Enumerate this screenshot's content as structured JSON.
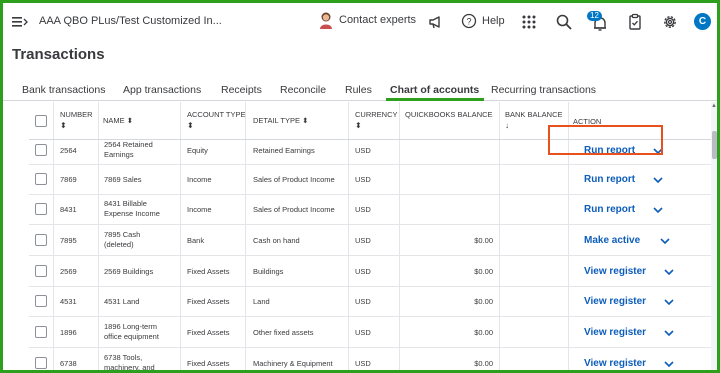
{
  "header": {
    "company_name": "AAA QBO PLus/Test Customized In...",
    "contact_label": "Contact experts",
    "help_label": "Help",
    "notification_count": "12",
    "avatar_initial": "C"
  },
  "page": {
    "title": "Transactions"
  },
  "tabs": [
    {
      "label": "Bank transactions",
      "active": false
    },
    {
      "label": "App transactions",
      "active": false
    },
    {
      "label": "Receipts",
      "active": false
    },
    {
      "label": "Reconcile",
      "active": false
    },
    {
      "label": "Rules",
      "active": false
    },
    {
      "label": "Chart of accounts",
      "active": true
    },
    {
      "label": "Recurring transactions",
      "active": false
    }
  ],
  "table": {
    "headers": {
      "number": "NUMBER",
      "name": "NAME",
      "account_type": "ACCOUNT TYPE",
      "detail_type": "DETAIL TYPE",
      "currency": "CURRENCY",
      "qb_balance": "QUICKBOOKS BALANCE",
      "bank_balance": "BANK BALANCE",
      "action": "ACTION"
    },
    "rows": [
      {
        "number": "2564",
        "name_l1": "2564 Retained",
        "name_l2": "Earnings",
        "account_type": "Equity",
        "detail_type": "Retained Earnings",
        "currency": "USD",
        "qb_balance": "",
        "action": "Run report",
        "highlighted": false
      },
      {
        "number": "7869",
        "name_l1": "7869 Sales",
        "name_l2": "",
        "account_type": "Income",
        "detail_type": "Sales of Product Income",
        "currency": "USD",
        "qb_balance": "",
        "action": "Run report",
        "highlighted": false
      },
      {
        "number": "8431",
        "name_l1": "8431 Billable",
        "name_l2": "Expense Income",
        "account_type": "Income",
        "detail_type": "Sales of Product Income",
        "currency": "USD",
        "qb_balance": "",
        "action": "Run report",
        "highlighted": false
      },
      {
        "number": "7895",
        "name_l1": "7895 Cash",
        "name_l2": "(deleted)",
        "account_type": "Bank",
        "detail_type": "Cash on hand",
        "currency": "USD",
        "qb_balance": "$0.00",
        "action": "Make active",
        "highlighted": true
      },
      {
        "number": "2569",
        "name_l1": "2569 Buildings",
        "name_l2": "",
        "account_type": "Fixed Assets",
        "detail_type": "Buildings",
        "currency": "USD",
        "qb_balance": "$0.00",
        "action": "View register",
        "highlighted": false
      },
      {
        "number": "4531",
        "name_l1": "4531 Land",
        "name_l2": "",
        "account_type": "Fixed Assets",
        "detail_type": "Land",
        "currency": "USD",
        "qb_balance": "$0.00",
        "action": "View register",
        "highlighted": false
      },
      {
        "number": "1896",
        "name_l1": "1896 Long-term",
        "name_l2": "office equipment",
        "account_type": "Fixed Assets",
        "detail_type": "Other fixed assets",
        "currency": "USD",
        "qb_balance": "$0.00",
        "action": "View register",
        "highlighted": false
      },
      {
        "number": "6738",
        "name_l1": "6738 Tools,",
        "name_l2": "machinery, and",
        "account_type": "Fixed Assets",
        "detail_type": "Machinery & Equipment",
        "currency": "USD",
        "qb_balance": "$0.00",
        "action": "View register",
        "highlighted": false
      }
    ]
  },
  "icons": {
    "menu": "hamburger-menu-icon",
    "megaphone": "megaphone-icon",
    "help": "help-circle-icon",
    "apps": "apps-grid-icon",
    "search": "search-icon",
    "notifications": "bell-icon",
    "tasks": "clipboard-icon",
    "settings": "gear-icon"
  },
  "colors": {
    "brand_green": "#2ca01c",
    "link_blue": "#0d5dbb",
    "highlight": "#e8511e"
  }
}
